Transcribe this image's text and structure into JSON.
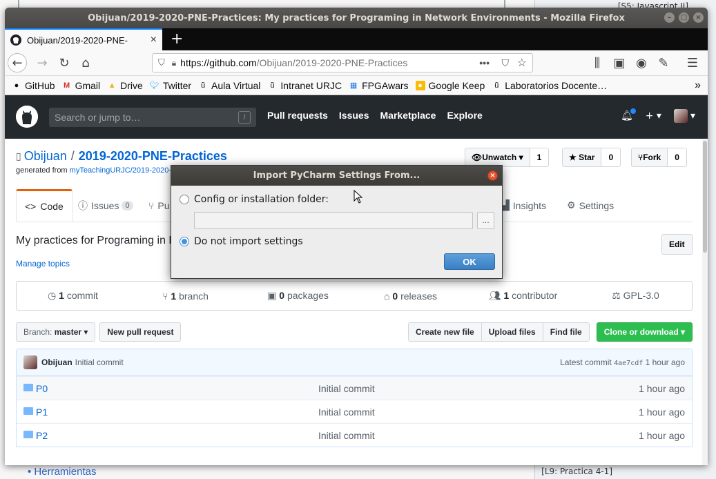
{
  "background": {
    "top_text": "[S5: Javascript II]",
    "bottom_text": "[L9: Practica 4-1]",
    "link": "Herramientas"
  },
  "window": {
    "title": "Obijuan/2019-2020-PNE-Practices: My practices for Programing in Network Environments - Mozilla Firefox"
  },
  "browser": {
    "tab_title": "Obijuan/2019-2020-PNE-",
    "url_host": "https://github.com",
    "url_path": "/Obijuan/2019-2020-PNE-Practices",
    "bookmarks": [
      "GitHub",
      "Gmail",
      "Drive",
      "Twitter",
      "Aula Virtual",
      "Intranet URJC",
      "FPGAwars",
      "Google Keep",
      "Laboratorios Docente…"
    ]
  },
  "github": {
    "search_placeholder": "Search or jump to…",
    "search_key": "/",
    "nav": [
      "Pull requests",
      "Issues",
      "Marketplace",
      "Explore"
    ],
    "owner": "Obijuan",
    "separator": "/",
    "repo": "2019-2020-PNE-Practices",
    "generated_label": "generated from",
    "generated_from": "myTeachingURJC/2019-2020-",
    "unwatch_label": "Unwatch",
    "unwatch_count": "1",
    "star_label": "Star",
    "star_count": "0",
    "fork_label": "Fork",
    "fork_count": "0",
    "tabs": {
      "code": "Code",
      "issues": "Issues",
      "issues_count": "0",
      "pulls": "Pu",
      "insights": "Insights",
      "settings": "Settings"
    },
    "description": "My practices for Programing in N",
    "manage_topics": "Manage topics",
    "edit": "Edit",
    "summary": [
      {
        "num": "1",
        "label": "commit"
      },
      {
        "num": "1",
        "label": "branch"
      },
      {
        "num": "0",
        "label": "packages"
      },
      {
        "num": "0",
        "label": "releases"
      },
      {
        "num": "1",
        "label": "contributor"
      },
      {
        "num": "",
        "label": "GPL-3.0"
      }
    ],
    "branch_label": "Branch:",
    "branch_name": "master",
    "new_pr": "New pull request",
    "create_file": "Create new file",
    "upload_files": "Upload files",
    "find_file": "Find file",
    "clone": "Clone or download",
    "commit_author": "Obijuan",
    "commit_msg": "Initial commit",
    "latest_label": "Latest commit",
    "latest_sha": "4ae7cdf",
    "latest_age": "1 hour ago",
    "files": [
      {
        "name": "P0",
        "msg": "Initial commit",
        "age": "1 hour ago"
      },
      {
        "name": "P1",
        "msg": "Initial commit",
        "age": "1 hour ago"
      },
      {
        "name": "P2",
        "msg": "Initial commit",
        "age": "1 hour ago"
      }
    ]
  },
  "dialog": {
    "title": "Import PyCharm Settings From...",
    "option1": "Config or installation folder:",
    "path_value": "",
    "browse": "...",
    "option2": "Do not import settings",
    "ok": "OK"
  }
}
